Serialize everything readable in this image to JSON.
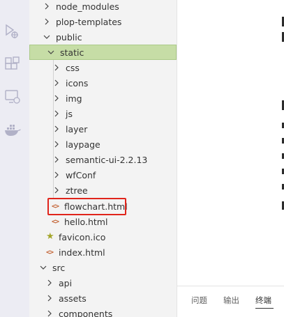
{
  "activity_bar": {
    "icons": [
      "run-debug-icon",
      "extensions-icon",
      "remote-explorer-icon",
      "docker-icon"
    ]
  },
  "tree": {
    "items": [
      {
        "label": "node_modules",
        "kind": "folder",
        "expanded": false,
        "depth": 1
      },
      {
        "label": "plop-templates",
        "kind": "folder",
        "expanded": false,
        "depth": 1
      },
      {
        "label": "public",
        "kind": "folder",
        "expanded": true,
        "depth": 1
      },
      {
        "label": "static",
        "kind": "folder",
        "expanded": true,
        "depth": 2,
        "selected": true
      },
      {
        "label": "css",
        "kind": "folder",
        "expanded": false,
        "depth": 3
      },
      {
        "label": "icons",
        "kind": "folder",
        "expanded": false,
        "depth": 3
      },
      {
        "label": "img",
        "kind": "folder",
        "expanded": false,
        "depth": 3
      },
      {
        "label": "js",
        "kind": "folder",
        "expanded": false,
        "depth": 3
      },
      {
        "label": "layer",
        "kind": "folder",
        "expanded": false,
        "depth": 3
      },
      {
        "label": "laypage",
        "kind": "folder",
        "expanded": false,
        "depth": 3
      },
      {
        "label": "semantic-ui-2.2.13",
        "kind": "folder",
        "expanded": false,
        "depth": 3
      },
      {
        "label": "wfConf",
        "kind": "folder",
        "expanded": false,
        "depth": 3
      },
      {
        "label": "ztree",
        "kind": "folder",
        "expanded": false,
        "depth": 3
      },
      {
        "label": "flowchart.html",
        "kind": "html",
        "depth": 3,
        "highlighted": true
      },
      {
        "label": "hello.html",
        "kind": "html",
        "depth": 3
      },
      {
        "label": "favicon.ico",
        "kind": "ico",
        "depth": 2
      },
      {
        "label": "index.html",
        "kind": "html",
        "depth": 2
      },
      {
        "label": "src",
        "kind": "folder",
        "expanded": true,
        "depth": 1
      },
      {
        "label": "api",
        "kind": "folder",
        "expanded": false,
        "depth": 2
      },
      {
        "label": "assets",
        "kind": "folder",
        "expanded": false,
        "depth": 2
      },
      {
        "label": "components",
        "kind": "folder",
        "expanded": false,
        "depth": 2
      }
    ]
  },
  "panel": {
    "tabs": [
      {
        "label": "问题"
      },
      {
        "label": "输出"
      },
      {
        "label": "终端",
        "active": true
      }
    ]
  },
  "colors": {
    "selected_bg": "#c6dda6",
    "highlight_border": "#e0241b",
    "html_icon": "#c5683a",
    "ico_icon": "#a3a52a"
  }
}
